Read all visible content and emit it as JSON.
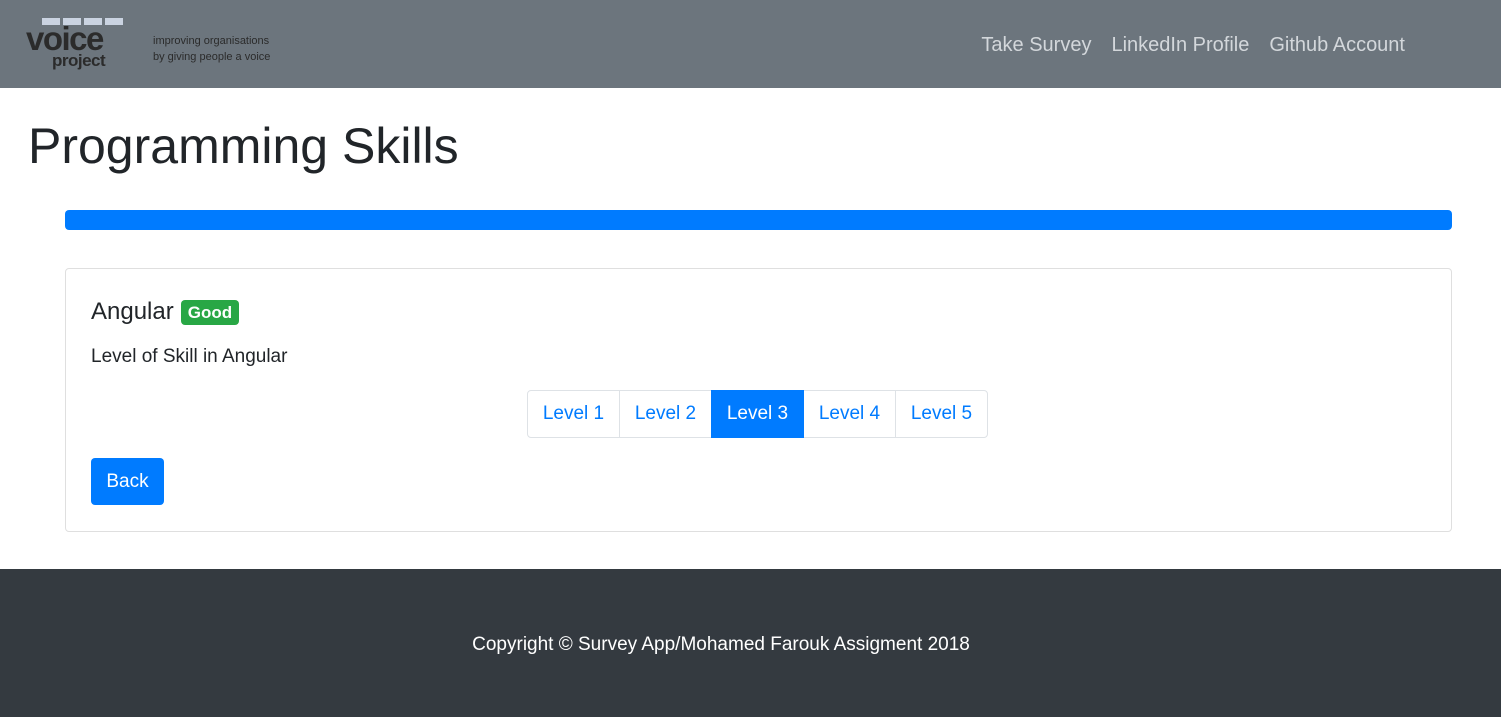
{
  "navbar": {
    "brand": {
      "word_top": "voice",
      "word_bottom": "project",
      "tagline_line1": "improving organisations",
      "tagline_line2": "by giving people a voice"
    },
    "links": [
      {
        "label": "Take Survey"
      },
      {
        "label": "LinkedIn Profile"
      },
      {
        "label": "Github Account"
      }
    ]
  },
  "page": {
    "title": "Programming Skills"
  },
  "progress": {
    "percent": 100,
    "color": "#007bff"
  },
  "question": {
    "skill": "Angular",
    "badge": "Good",
    "badge_color": "#28a745",
    "text": "Level of Skill in Angular",
    "levels": [
      "Level 1",
      "Level 2",
      "Level 3",
      "Level 4",
      "Level 5"
    ],
    "selected_level": "Level 3",
    "back_label": "Back"
  },
  "footer": {
    "copyright": "Copyright © Survey App/Mohamed Farouk Assigment 2018"
  },
  "colors": {
    "navbar_bg": "#6c757d",
    "primary": "#007bff",
    "footer_bg": "#343a40"
  }
}
